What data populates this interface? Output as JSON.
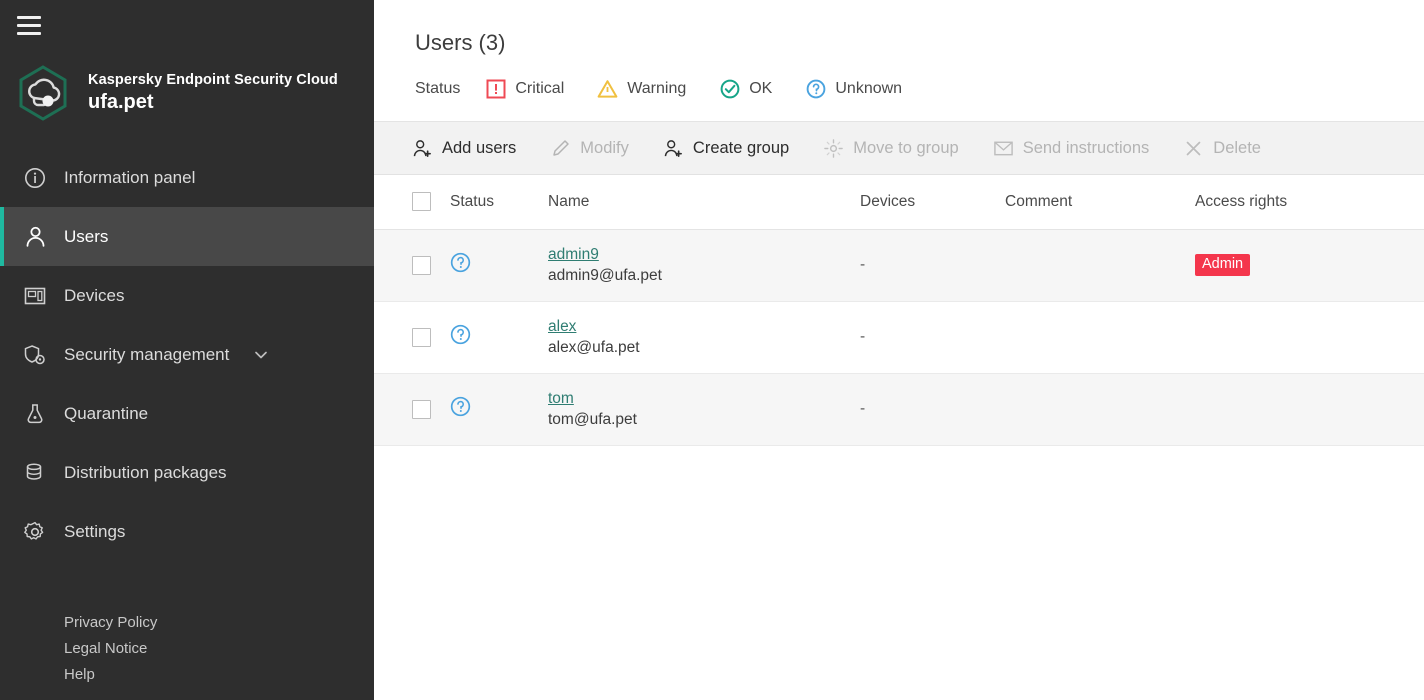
{
  "sidebar": {
    "menu_icon": "hamburger-icon",
    "brand": {
      "logo_icon": "kaspersky-cloud-hexagon-logo",
      "product": "Kaspersky Endpoint Security Cloud",
      "tenant": "ufa.pet"
    },
    "items": [
      {
        "label": "Information panel",
        "icon": "info-circle-icon",
        "active": false,
        "chevron": false
      },
      {
        "label": "Users",
        "icon": "user-icon",
        "active": true,
        "chevron": false
      },
      {
        "label": "Devices",
        "icon": "monitor-icon",
        "active": false,
        "chevron": false
      },
      {
        "label": "Security management",
        "icon": "shield-gear-icon",
        "active": false,
        "chevron": true
      },
      {
        "label": "Quarantine",
        "icon": "flask-icon",
        "active": false,
        "chevron": false
      },
      {
        "label": "Distribution packages",
        "icon": "database-icon",
        "active": false,
        "chevron": false
      },
      {
        "label": "Settings",
        "icon": "gear-icon",
        "active": false,
        "chevron": false
      }
    ],
    "footer_links": [
      "Privacy Policy",
      "Legal Notice",
      "Help"
    ],
    "accent_color": "#1fb9a0",
    "background_color": "#2e2e2e"
  },
  "main": {
    "page_title": "Users (3)",
    "status_filter": {
      "label": "Status",
      "options": [
        {
          "label": "Critical",
          "icon": "critical-exclamation-icon",
          "color": "#ef4a54"
        },
        {
          "label": "Warning",
          "icon": "warning-triangle-icon",
          "color": "#f0c040"
        },
        {
          "label": "OK",
          "icon": "ok-check-circle-icon",
          "color": "#17a589"
        },
        {
          "label": "Unknown",
          "icon": "unknown-question-icon",
          "color": "#4aa3df"
        }
      ]
    },
    "toolbar": [
      {
        "label": "Add users",
        "icon": "user-plus-icon",
        "disabled": false
      },
      {
        "label": "Modify",
        "icon": "pencil-icon",
        "disabled": true
      },
      {
        "label": "Create group",
        "icon": "user-plus-icon",
        "disabled": false
      },
      {
        "label": "Move to group",
        "icon": "move-target-icon",
        "disabled": true
      },
      {
        "label": "Send instructions",
        "icon": "envelope-icon",
        "disabled": true
      },
      {
        "label": "Delete",
        "icon": "close-x-icon",
        "disabled": true
      }
    ],
    "table": {
      "columns": [
        "",
        "Status",
        "Name",
        "Devices",
        "Comment",
        "Access rights"
      ],
      "select_all_checkbox": false,
      "rows": [
        {
          "selected": false,
          "status_icon": "unknown-question-icon",
          "name": "admin9",
          "email": "admin9@ufa.pet",
          "devices": "-",
          "comment": "",
          "access_rights": "Admin",
          "access_badge_color": "#f4364c"
        },
        {
          "selected": false,
          "status_icon": "unknown-question-icon",
          "name": "alex",
          "email": "alex@ufa.pet",
          "devices": "-",
          "comment": "",
          "access_rights": "",
          "access_badge_color": ""
        },
        {
          "selected": false,
          "status_icon": "unknown-question-icon",
          "name": "tom",
          "email": "tom@ufa.pet",
          "devices": "-",
          "comment": "",
          "access_rights": "",
          "access_badge_color": ""
        }
      ]
    }
  }
}
